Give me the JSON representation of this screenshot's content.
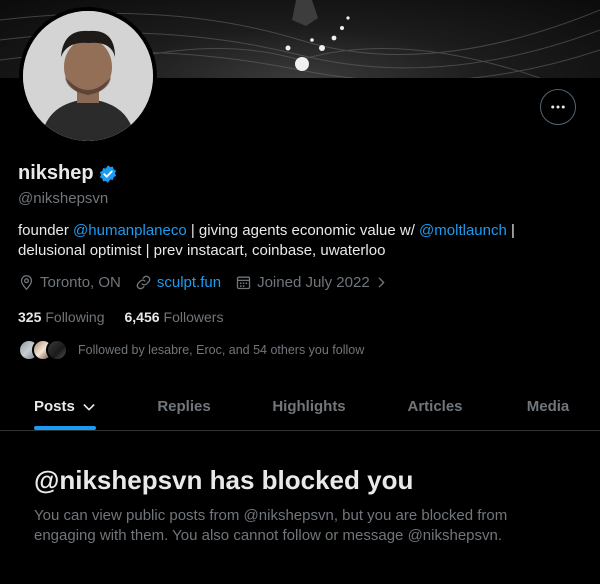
{
  "profile": {
    "display_name": "nikshep",
    "handle": "@nikshepsvn",
    "bio": {
      "part1": "founder ",
      "mention1": "@humanplaneco",
      "part2": " | giving agents economic value w/ ",
      "mention2": "@moltlaunch",
      "part3": " | delusional optimist | prev instacart, coinbase, uwaterloo"
    },
    "location": "Toronto, ON",
    "website": "sculpt.fun",
    "joined": "Joined July 2022",
    "following_count": "325",
    "following_label": "Following",
    "followers_count": "6,456",
    "followers_label": "Followers",
    "followed_by": "Followed by lesabre, Eroc, and 54 others you follow"
  },
  "tabs": [
    {
      "label": "Posts"
    },
    {
      "label": "Replies"
    },
    {
      "label": "Highlights"
    },
    {
      "label": "Articles"
    },
    {
      "label": "Media"
    }
  ],
  "blocked": {
    "title": "@nikshepsvn has blocked you",
    "body": "You can view public posts from @nikshepsvn, but you are blocked from engaging with them. You also cannot follow or message @nikshepsvn."
  },
  "colors": {
    "accent": "#1d9bf0",
    "background": "#000000",
    "text_primary": "#e7e9ea",
    "text_secondary": "#71767b"
  },
  "icons": {
    "verified": "verified-badge-icon",
    "more": "more-icon",
    "location": "location-pin-icon",
    "link": "link-icon",
    "calendar": "calendar-icon"
  }
}
